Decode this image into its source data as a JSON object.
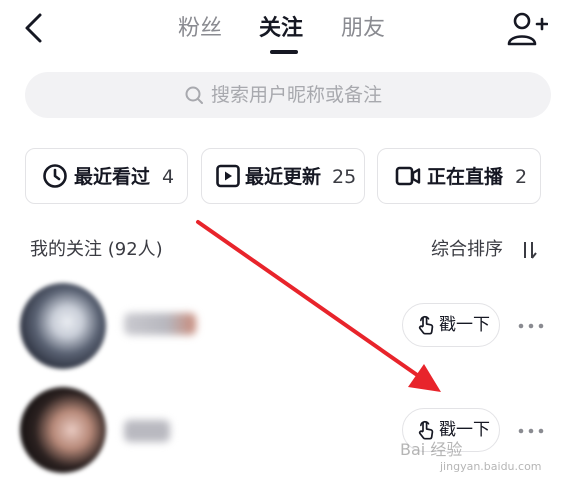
{
  "nav": {
    "tabs": [
      {
        "label": "粉丝",
        "active": false
      },
      {
        "label": "关注",
        "active": true
      },
      {
        "label": "朋友",
        "active": false
      }
    ]
  },
  "search": {
    "placeholder": "搜索用户昵称或备注"
  },
  "filters": [
    {
      "label": "最近看过",
      "count": "4",
      "icon": "clock-icon"
    },
    {
      "label": "最近更新",
      "count": "25",
      "icon": "play-icon"
    },
    {
      "label": "正在直播",
      "count": "2",
      "icon": "video-camera-icon"
    }
  ],
  "following": {
    "title": "我的关注 (92人)",
    "sort_label": "综合排序",
    "items": [
      {
        "poke_label": "戳一下"
      },
      {
        "poke_label": "戳一下"
      }
    ]
  },
  "watermark": {
    "text": "Bai 经验",
    "url": "jingyan.baidu.com"
  },
  "colors": {
    "text_primary": "#161823",
    "text_secondary": "#8a8b91",
    "border": "#e3e3e6",
    "search_bg": "#f2f2f4",
    "annotation_arrow": "#e8242b"
  }
}
